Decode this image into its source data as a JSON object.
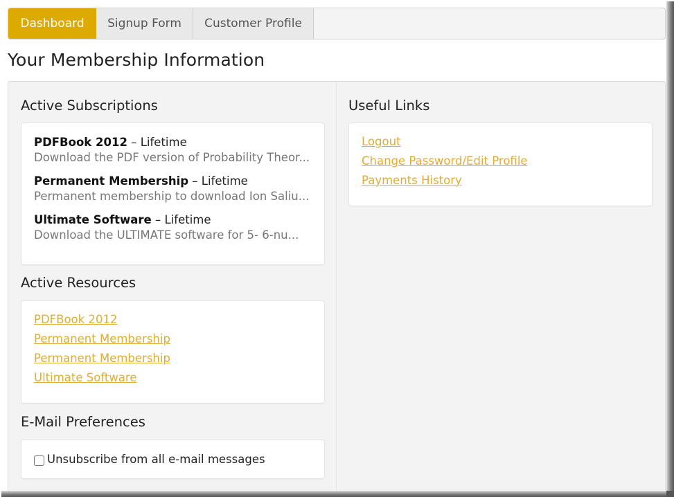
{
  "tabs": [
    {
      "label": "Dashboard",
      "active": true
    },
    {
      "label": "Signup Form",
      "active": false
    },
    {
      "label": "Customer Profile",
      "active": false
    }
  ],
  "page_title": "Your Membership Information",
  "colors": {
    "accent": "#dcaa00",
    "link": "#dfae32",
    "panel_bg": "#f3f3f3"
  },
  "subscriptions": {
    "title": "Active Subscriptions",
    "items": [
      {
        "name": "PDFBook 2012",
        "separator": " – ",
        "term": "Lifetime",
        "description": "Download the PDF version of Probability Theor..."
      },
      {
        "name": "Permanent Membership",
        "separator": " – ",
        "term": "Lifetime",
        "description": "Permanent membership to download Ion Saliu..."
      },
      {
        "name": "Ultimate Software",
        "separator": " – ",
        "term": "Lifetime",
        "description": "Download the ULTIMATE software for 5- 6-nu..."
      }
    ]
  },
  "resources": {
    "title": "Active Resources",
    "links": [
      "PDFBook 2012",
      "Permanent Membership",
      "Permanent Membership",
      "Ultimate Software"
    ]
  },
  "email_prefs": {
    "title": "E-Mail Preferences",
    "unsubscribe_label": "Unsubscribe from all e-mail messages",
    "unsubscribe_checked": false
  },
  "useful_links": {
    "title": "Useful Links",
    "links": [
      "Logout",
      "Change Password/Edit Profile",
      "Payments History"
    ]
  }
}
